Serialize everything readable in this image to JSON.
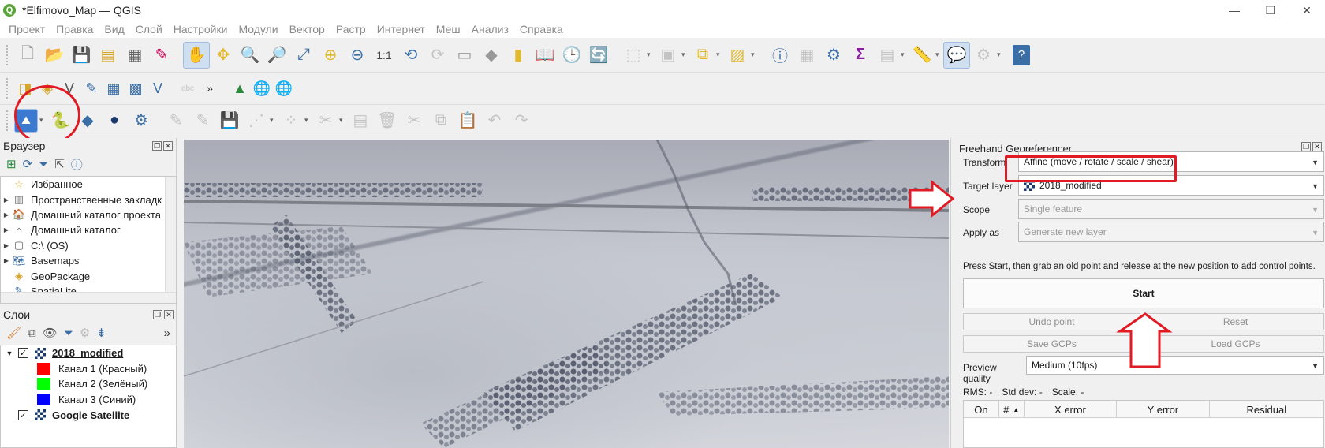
{
  "window": {
    "title": "*Elfimovo_Map — QGIS",
    "minimize_glyph": "—",
    "maximize_glyph": "❐",
    "close_glyph": "✕"
  },
  "menu": [
    "Проект",
    "Правка",
    "Вид",
    "Слой",
    "Настройки",
    "Модули",
    "Вектор",
    "Растр",
    "Интернет",
    "Меш",
    "Анализ",
    "Справка"
  ],
  "browser": {
    "title": "Браузер",
    "items": [
      {
        "label": "Избранное",
        "icon": "star-icon",
        "glyph": "☆",
        "expandable": false
      },
      {
        "label": "Пространственные закладк",
        "icon": "bookmark-icon",
        "glyph": "▥",
        "expandable": true
      },
      {
        "label": "Домашний каталог проекта",
        "icon": "home-folder-icon",
        "glyph": "🏠",
        "expandable": true
      },
      {
        "label": "Домашний каталог",
        "icon": "home-icon",
        "glyph": "⌂",
        "expandable": true
      },
      {
        "label": "C:\\ (OS)",
        "icon": "drive-icon",
        "glyph": "▢",
        "expandable": true
      },
      {
        "label": "Basemaps",
        "icon": "basemaps-icon",
        "glyph": "🗺",
        "expandable": true
      },
      {
        "label": "GeoPackage",
        "icon": "geopackage-icon",
        "glyph": "◈",
        "expandable": false
      },
      {
        "label": "SpatiaLite",
        "icon": "spatialite-icon",
        "glyph": "✎",
        "expandable": false
      }
    ]
  },
  "layers": {
    "title": "Слои",
    "rows": [
      {
        "label": "2018_modified",
        "type": "layer",
        "checked": true,
        "bold": true,
        "underline": true
      },
      {
        "label": "Канал 1 (Красный)",
        "type": "band",
        "color": "#ff0000"
      },
      {
        "label": "Канал 2 (Зелёный)",
        "type": "band",
        "color": "#00ff00"
      },
      {
        "label": "Канал 3 (Синий)",
        "type": "band",
        "color": "#0000ff"
      },
      {
        "label": "Google Satellite",
        "type": "layer",
        "checked": true,
        "bold": true,
        "underline": false
      }
    ]
  },
  "georef": {
    "title": "Freehand Georeferencer",
    "transform_label": "Transform",
    "transform_value": "Affine (move / rotate / scale / shear)",
    "target_label": "Target layer",
    "target_value": "2018_modified",
    "scope_label": "Scope",
    "scope_value": "Single feature",
    "apply_label": "Apply as",
    "apply_value": "Generate new layer",
    "hint": "Press Start, then grab an old point and release at the new position to add control points.",
    "start_label": "Start",
    "undo_label": "Undo point",
    "reset_label": "Reset",
    "save_gcps_label": "Save GCPs",
    "load_gcps_label": "Load GCPs",
    "preview_label": "Preview quality",
    "preview_value": "Medium (10fps)",
    "rms": "RMS: -",
    "stddev": "Std dev: -",
    "scale": "Scale: -",
    "columns": [
      "On",
      "#",
      "X error",
      "Y error",
      "Residual"
    ]
  },
  "colors": {
    "annotation": "#e01b24",
    "qgis_green": "#5aa33a"
  }
}
